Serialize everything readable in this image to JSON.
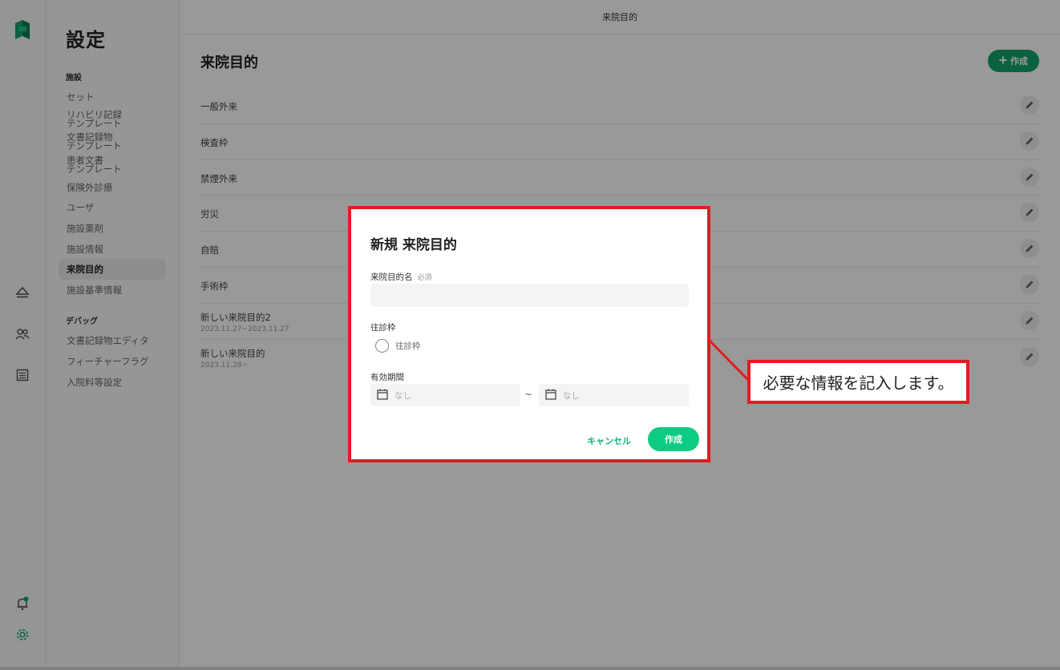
{
  "sidebar": {
    "title": "設定",
    "groups": [
      "施設",
      "デバッグ"
    ],
    "items": [
      {
        "label": "セット"
      },
      {
        "label": "リハビリ記録\nテンプレート"
      },
      {
        "label": "文書記録物\nテンプレート"
      },
      {
        "label": "患者文書\nテンプレート"
      },
      {
        "label": "保険外診療"
      },
      {
        "label": "ユーザ"
      },
      {
        "label": "施設薬剤"
      },
      {
        "label": "施設情報"
      },
      {
        "label": "来院目的",
        "active": true
      },
      {
        "label": "施設基準情報"
      },
      {
        "label": "文書記録物エディタ"
      },
      {
        "label": "フィーチャーフラグ"
      },
      {
        "label": "入院料等設定"
      }
    ]
  },
  "header": {
    "title": "来院目的"
  },
  "main": {
    "title": "来院目的",
    "create_label": "作成",
    "rows": [
      {
        "name": "一般外来",
        "sub": ""
      },
      {
        "name": "検査枠",
        "sub": ""
      },
      {
        "name": "禁煙外来",
        "sub": ""
      },
      {
        "name": "労災",
        "sub": ""
      },
      {
        "name": "自賠",
        "sub": ""
      },
      {
        "name": "手術枠",
        "sub": ""
      },
      {
        "name": "新しい来院目的2",
        "sub": "2023.11.27~2023.11.27"
      },
      {
        "name": "新しい来院目的",
        "sub": "2023.11.28~"
      }
    ]
  },
  "dialog": {
    "title": "新規 来院目的",
    "name_label": "来院目的名",
    "required": "必須",
    "name_value": "",
    "visit_label": "往診枠",
    "visit_option": "往診枠",
    "period_label": "有効期間",
    "start_placeholder": "なし",
    "end_placeholder": "なし",
    "tilde": "~",
    "cancel_label": "キャンセル",
    "submit_label": "作成"
  },
  "callout": {
    "text": "必要な情報を記入します。"
  },
  "colors": {
    "accent": "#11a46a",
    "annotation": "#e31b23"
  }
}
